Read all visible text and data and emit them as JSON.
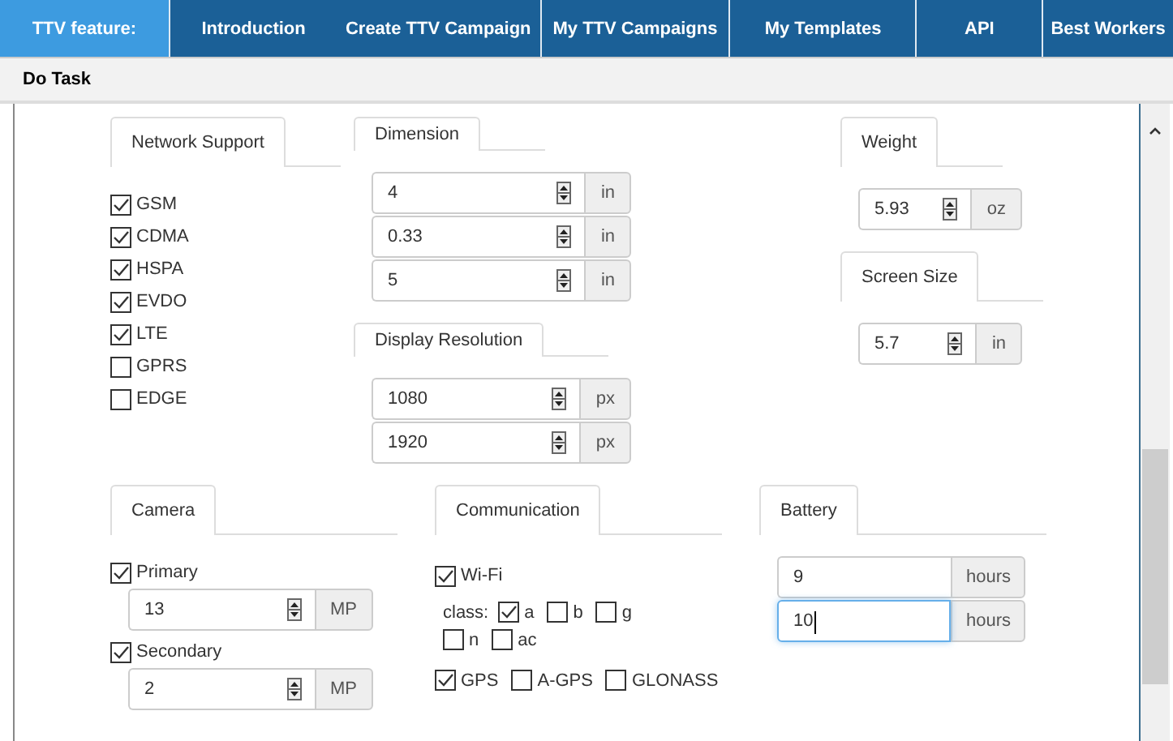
{
  "nav": {
    "items": [
      {
        "label": "TTV feature:",
        "selected": true
      },
      {
        "label": "Introduction",
        "selected": false
      },
      {
        "label": "Create TTV Campaign",
        "selected": false
      },
      {
        "label": "My TTV Campaigns",
        "selected": false
      },
      {
        "label": "My Templates",
        "selected": false
      },
      {
        "label": "API",
        "selected": false
      },
      {
        "label": "Best Workers",
        "selected": false
      }
    ]
  },
  "page_title": "Do Task",
  "network_support": {
    "title": "Network Support",
    "options": [
      {
        "label": "GSM",
        "checked": true
      },
      {
        "label": "CDMA",
        "checked": true
      },
      {
        "label": "HSPA",
        "checked": true
      },
      {
        "label": "EVDO",
        "checked": true
      },
      {
        "label": "LTE",
        "checked": true
      },
      {
        "label": "GPRS",
        "checked": false
      },
      {
        "label": "EDGE",
        "checked": false
      }
    ]
  },
  "dimension": {
    "title": "Dimension",
    "fields": [
      {
        "value": "4",
        "unit": "in"
      },
      {
        "value": "0.33",
        "unit": "in"
      },
      {
        "value": "5",
        "unit": "in"
      }
    ]
  },
  "display_resolution": {
    "title": "Display Resolution",
    "fields": [
      {
        "value": "1080",
        "unit": "px"
      },
      {
        "value": "1920",
        "unit": "px"
      }
    ]
  },
  "weight": {
    "title": "Weight",
    "fields": [
      {
        "value": "5.93",
        "unit": "oz"
      }
    ]
  },
  "screen_size": {
    "title": "Screen Size",
    "fields": [
      {
        "value": "5.7",
        "unit": "in"
      }
    ]
  },
  "camera": {
    "title": "Camera",
    "items": [
      {
        "label": "Primary",
        "checked": true,
        "value": "13",
        "unit": "MP"
      },
      {
        "label": "Secondary",
        "checked": true,
        "value": "2",
        "unit": "MP"
      }
    ]
  },
  "communication": {
    "title": "Communication",
    "wifi": {
      "label": "Wi-Fi",
      "checked": true
    },
    "class_label": "class:",
    "classes": [
      {
        "label": "a",
        "checked": true
      },
      {
        "label": "b",
        "checked": false
      },
      {
        "label": "g",
        "checked": false
      },
      {
        "label": "n",
        "checked": false
      },
      {
        "label": "ac",
        "checked": false
      }
    ],
    "location": [
      {
        "label": "GPS",
        "checked": true
      },
      {
        "label": "A-GPS",
        "checked": false
      },
      {
        "label": "GLONASS",
        "checked": false
      }
    ]
  },
  "battery": {
    "title": "Battery",
    "fields": [
      {
        "value": "9",
        "unit": "hours",
        "focused": false
      },
      {
        "value": "10",
        "unit": "hours",
        "focused": true
      }
    ]
  }
}
